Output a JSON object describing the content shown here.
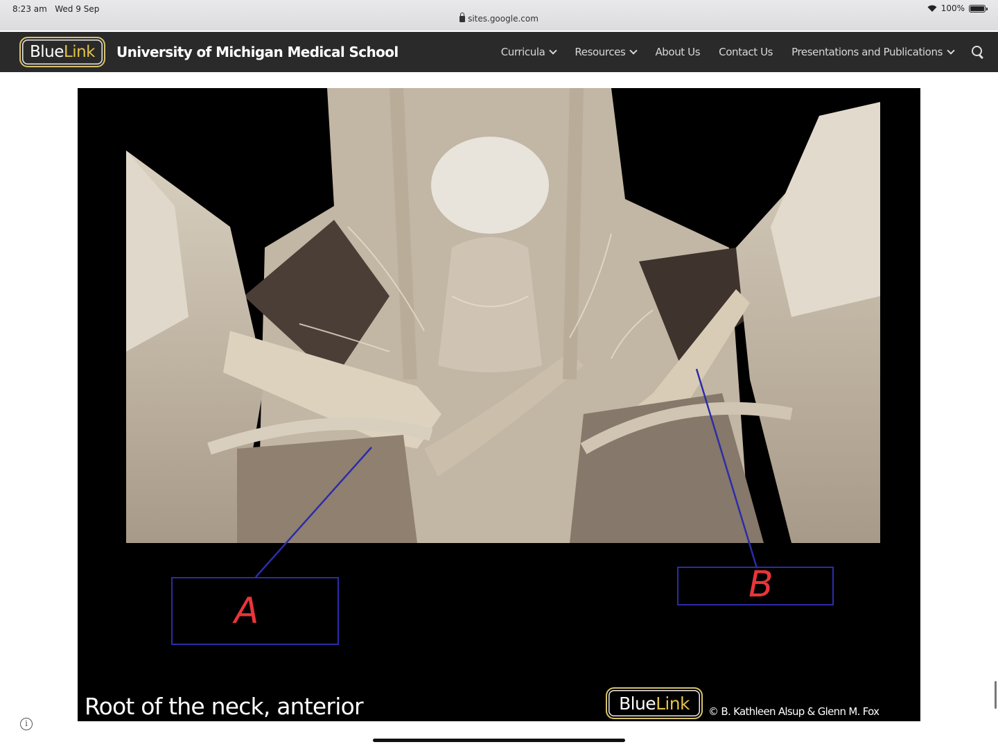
{
  "status": {
    "time": "8:23 am",
    "date": "Wed 9 Sep",
    "battery": "100%",
    "url": "sites.google.com"
  },
  "site": {
    "logo_blue": "Blue",
    "logo_link": "Link",
    "title": "University of Michigan Medical School",
    "nav": [
      {
        "label": "Curricula",
        "icon": "chevron-down-icon"
      },
      {
        "label": "Resources",
        "icon": "chevron-down-icon"
      },
      {
        "label": "About Us"
      },
      {
        "label": "Contact Us"
      },
      {
        "label": "Presentations and Publications",
        "icon": "chevron-down-icon"
      }
    ],
    "search_icon": "search-icon"
  },
  "figure": {
    "caption": "Root of the neck, anterior",
    "logo_blue": "Blue",
    "logo_link": "Link",
    "copyright": "© B. Kathleen Alsup & Glenn M. Fox",
    "labels": [
      {
        "letter": "A"
      },
      {
        "letter": "B"
      }
    ],
    "colors": {
      "label_box": "#2c2ca8",
      "label_letter": "#e8353a",
      "leader_line": "#2c2ca8"
    }
  }
}
